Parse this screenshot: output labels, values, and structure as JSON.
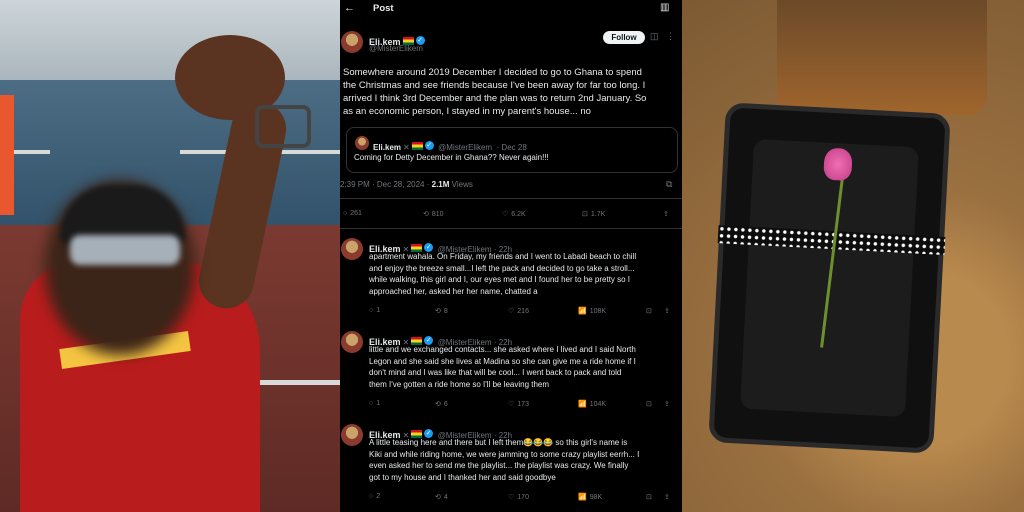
{
  "header": {
    "title": "Post"
  },
  "post": {
    "name": "Eli.kem",
    "handle": "@MisterElikem",
    "follow_label": "Follow",
    "text_lines": [
      "Somewhere around 2019 December I decided to go to Ghana to spend",
      "the Christmas and see friends because I've been away for far too long. I",
      "arrived I think 3rd December and the plan was to return 2nd January. So",
      "as an economic person, I stayed in my parent's house... no"
    ],
    "quote": {
      "name": "Eli.kem",
      "handle": "@MisterElikem",
      "date": "· Dec 28",
      "text": "Coming for Detty December in Ghana?? Never again!!!"
    },
    "timestamp": "2:39 PM · Dec 28, 2024 ·",
    "views_count": "2.1M",
    "views_label": "Views",
    "stats": {
      "replies": "261",
      "reposts": "810",
      "likes": "6.2K",
      "bookmarks": "1.7K"
    }
  },
  "replies": [
    {
      "name": "Eli.kem",
      "handle": "@MisterElikem · 22h",
      "lines": [
        "apartment wahala. On Friday, my friends and I went to Labadi beach to chill",
        "and enjoy the breeze small...I left the pack and decided to go take a stroll...",
        "while walking, this girl and I, our eyes met and I found her to be pretty so I",
        "approached her, asked her her name, chatted a"
      ],
      "stats": {
        "replies": "1",
        "reposts": "8",
        "likes": "216",
        "views": "108K"
      }
    },
    {
      "name": "Eli.kem",
      "handle": "@MisterElikem · 22h",
      "lines": [
        "little and we exchanged contacts... she asked where I lived and I said North",
        "Legon and she said she lives at Madina so she can give me a ride home if I",
        "don't mind and I was like that will be cool... I went back to pack and told",
        "them I've gotten a ride home so I'll be leaving them"
      ],
      "stats": {
        "replies": "1",
        "reposts": "6",
        "likes": "173",
        "views": "104K"
      }
    },
    {
      "name": "Eli.kem",
      "handle": "@MisterElikem · 22h",
      "lines": [
        "A little teasing here and there but I left them😂😂😂 so this girl's name is",
        "Kiki and while riding home, we were jamming to some crazy playlist eerrh... I",
        "even asked her to send me the playlist... the playlist was crazy. We finally",
        "got to my house and I thanked her and said goodbye"
      ],
      "stats": {
        "replies": "2",
        "reposts": "4",
        "likes": "170",
        "views": "98K"
      }
    }
  ],
  "icons": {
    "back": "←",
    "reader": "▥",
    "grok": "◫",
    "more": "⋮",
    "reply": "○",
    "repost": "⟲",
    "like": "♡",
    "bookmark": "⊡",
    "share": "⇪",
    "views": "📶",
    "analytics": "⧉"
  },
  "colors": {
    "accent": "#1d9bf0",
    "background": "#000000",
    "muted": "#71767b"
  }
}
